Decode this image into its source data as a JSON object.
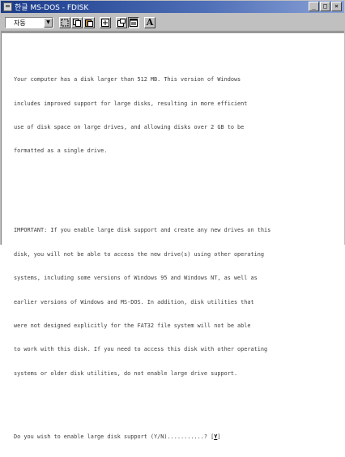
{
  "window": {
    "title": "한글 MS-DOS - FDISK",
    "buttons": {
      "minimize": "_",
      "maximize": "□",
      "close": "×"
    }
  },
  "toolbar": {
    "font_select_value": "자동",
    "font_select_arrow": "▼",
    "font_button": "A"
  },
  "console": {
    "paragraph1": [
      "Your computer has a disk larger than 512 MB. This version of Windows",
      "includes improved support for large disks, resulting in more efficient",
      "use of disk space on large drives, and allowing disks over 2 GB to be",
      "formatted as a single drive."
    ],
    "paragraph2": [
      "IMPORTANT: If you enable large disk support and create any new drives on this",
      "disk, you will not be able to access the new drive(s) using other operating",
      "systems, including some versions of Windows 95 and Windows NT, as well as",
      "earlier versions of Windows and MS-DOS. In addition, disk utilities that",
      "were not designed explicitly for the FAT32 file system will not be able",
      "to work with this disk. If you need to access this disk with other operating",
      "systems or older disk utilities, do not enable large drive support."
    ],
    "prompt": "Do you wish to enable large disk support (Y/N)...........? ",
    "answer_open": "[",
    "answer": "Y",
    "answer_close": "]"
  }
}
